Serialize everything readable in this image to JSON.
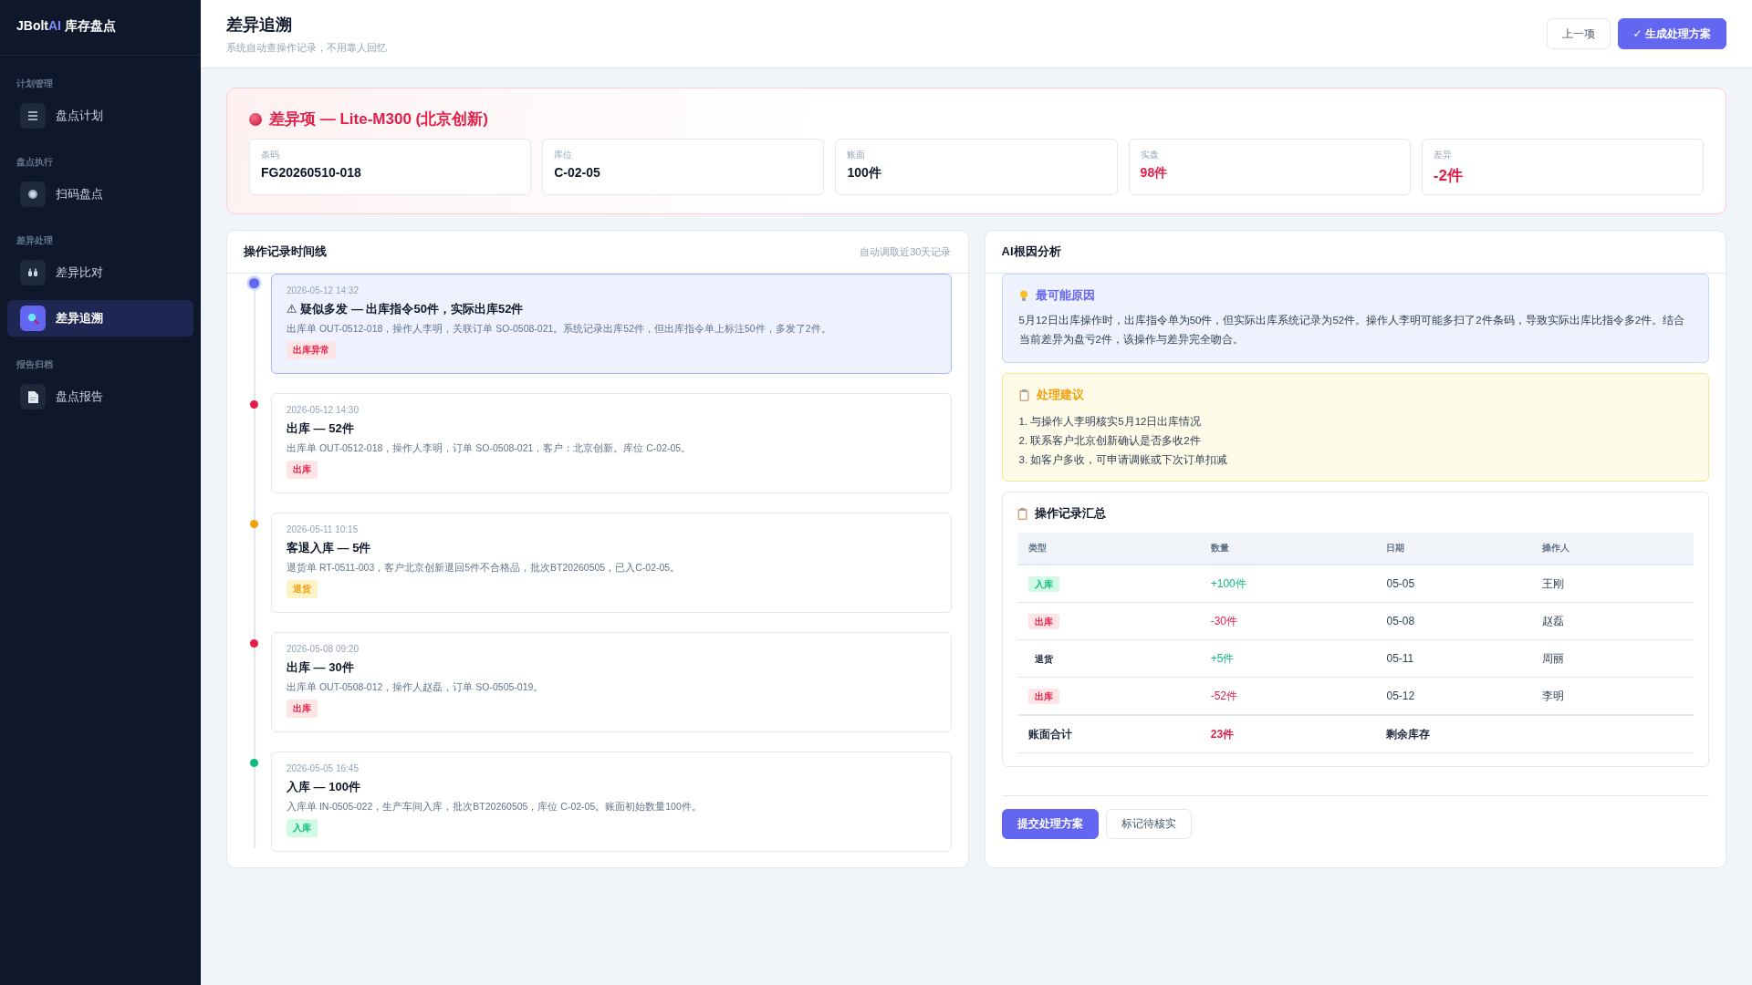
{
  "brand": {
    "name": "JBolt",
    "accent": "AI",
    "suffix": "库存盘点"
  },
  "sidebar": {
    "sections": [
      {
        "label": "计划管理",
        "items": [
          {
            "label": "盘点计划",
            "kind": "list",
            "selected": false
          }
        ]
      },
      {
        "label": "盘点执行",
        "items": [
          {
            "label": "扫码盘点",
            "kind": "target",
            "selected": false
          }
        ]
      },
      {
        "label": "差异处理",
        "items": [
          {
            "label": "差异比对",
            "kind": "compare",
            "selected": false
          },
          {
            "label": "差异追溯",
            "kind": "search",
            "selected": true
          }
        ]
      },
      {
        "label": "报告归档",
        "items": [
          {
            "label": "盘点报告",
            "kind": "document",
            "selected": false
          }
        ]
      }
    ]
  },
  "header": {
    "title": "差异追溯",
    "subtitle": "系统自动查操作记录，不用靠人回忆",
    "buttons": [
      {
        "label": "上一项",
        "kind": "secondary"
      },
      {
        "label": "✓ 生成处理方案",
        "kind": "primary"
      }
    ]
  },
  "discrepancy": {
    "title": "差异项 — Lite-M300 (北京创新)",
    "fields": [
      {
        "label": "条码",
        "value": "FG20260510-018",
        "kind": "plain"
      },
      {
        "label": "库位",
        "value": "C-02-05",
        "kind": "plain"
      },
      {
        "label": "账面",
        "value": "100件",
        "kind": "plain"
      },
      {
        "label": "实盘",
        "value": "98件",
        "kind": "alert"
      },
      {
        "label": "差异",
        "value": "-2件",
        "kind": "alert-strong"
      }
    ]
  },
  "timeline": {
    "title": "操作记录时间线",
    "note": "自动调取近30天记录",
    "entries": [
      {
        "time": "2026-05-12 14:32",
        "title": "⚠ 疑似多发 — 出库指令50件，实际出库52件",
        "detail": "出库单 OUT-0512-018，操作人李明，关联订单 SO-0508-021。系统记录出库52件，但出库指令单上标注50件，多发了2件。",
        "tag": "出库异常",
        "kind": "out",
        "color": "#6366f1",
        "selected": true
      },
      {
        "time": "2026-05-12 14:30",
        "title": "出库 — 52件",
        "detail": "出库单 OUT-0512-018，操作人李明，订单 SO-0508-021，客户：北京创新。库位 C-02-05。",
        "tag": "出库",
        "kind": "out",
        "color": "#e11d48",
        "selected": false
      },
      {
        "time": "2026-05-11 10:15",
        "title": "客退入库 — 5件",
        "detail": "退货单 RT-0511-003，客户北京创新退回5件不合格品，批次BT20260505，已入C-02-05。",
        "tag": "退货",
        "kind": "return",
        "color": "#f59e0b",
        "selected": false
      },
      {
        "time": "2026-05-08 09:20",
        "title": "出库 — 30件",
        "detail": "出库单 OUT-0508-012，操作人赵磊，订单 SO-0505-019。",
        "tag": "出库",
        "kind": "out",
        "color": "#e11d48",
        "selected": false
      },
      {
        "time": "2026-05-05 16:45",
        "title": "入库 — 100件",
        "detail": "入库单 IN-0505-022，生产车间入库，批次BT20260505，库位 C-02-05。账面初始数量100件。",
        "tag": "入库",
        "kind": "in",
        "color": "#10b981",
        "selected": false
      }
    ]
  },
  "analysis": {
    "title": "AI根因分析",
    "cause": {
      "title": "最可能原因",
      "text": "5月12日出库操作时，出库指令单为50件，但实际出库系统记录为52件。操作人李明可能多扫了2件条码，导致实际出库比指令多2件。结合当前差异为盘亏2件，该操作与差异完全吻合。"
    },
    "advice": {
      "title": "处理建议",
      "items": [
        "1. 与操作人李明核实5月12日出库情况",
        "2. 联系客户北京创新确认是否多收2件",
        "3. 如客户多收，可申请调账或下次订单扣减"
      ]
    },
    "summary": {
      "title": "操作记录汇总",
      "columns": [
        "类型",
        "数量",
        "日期",
        "操作人"
      ],
      "rows": [
        {
          "type": "入库",
          "kind": "in",
          "qty": "+100件",
          "date": "05-05",
          "operator": "王刚"
        },
        {
          "type": "出库",
          "kind": "out",
          "qty": "-30件",
          "date": "05-08",
          "operator": "赵磊"
        },
        {
          "type": "退货",
          "kind": "return",
          "qty": "+5件",
          "date": "05-11",
          "operator": "周丽"
        },
        {
          "type": "出库",
          "kind": "out",
          "qty": "-52件",
          "date": "05-12",
          "operator": "李明"
        }
      ],
      "total": {
        "label": "账面合计",
        "value": "23件",
        "note": "剩余库存"
      }
    },
    "buttons": [
      {
        "label": "提交处理方案",
        "kind": "primary"
      },
      {
        "label": "标记待核实",
        "kind": "secondary"
      }
    ]
  }
}
